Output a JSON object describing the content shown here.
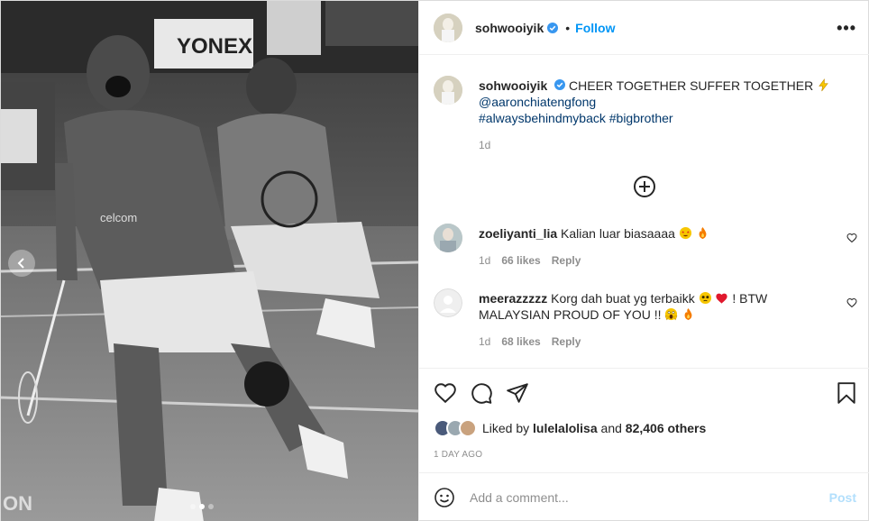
{
  "post": {
    "author": "sohwooiyik",
    "follow_label": "Follow",
    "separator": "•",
    "more_label": "•••",
    "caption": {
      "username": "sohwooiyik",
      "text": "CHEER TOGETHER SUFFER TOGETHER",
      "mention": "@aaronchiatengfong",
      "hashtag1": "#alwaysbehindmyback",
      "hashtag2": "#bigbrother",
      "time": "1d"
    },
    "comments": [
      {
        "username": "zoeliyanti_lia",
        "text": "Kalian luar biasaaaa",
        "time": "1d",
        "likes": "66 likes",
        "reply": "Reply"
      },
      {
        "username": "meerazzzzz",
        "text_part1": "Korg dah buat yg terbaikk",
        "text_part2": "! BTW",
        "text_part3": "MALAYSIAN PROUD OF YOU !!",
        "time": "1d",
        "likes": "68 likes",
        "reply": "Reply"
      }
    ],
    "likes": {
      "prefix": "Liked by",
      "user": "lulelalolisa",
      "suffix": "and",
      "count": "82,406 others"
    },
    "date": "1 DAY AGO",
    "comment_placeholder": "Add a comment...",
    "post_label": "Post",
    "photo_text": {
      "brand1": "YONEX",
      "brand2": "celcom",
      "corner": "ON"
    }
  },
  "colors": {
    "accent": "#0095f6",
    "verified": "#3897f0",
    "link": "#00376b",
    "muted": "#8e8e8e",
    "post_disabled": "#b2dffc"
  },
  "icons": {
    "verified": "verified-badge-icon",
    "load_more": "plus-circle-icon",
    "heart": "heart-icon",
    "comment": "comment-icon",
    "share": "share-icon",
    "save": "bookmark-icon",
    "emoji": "smile-icon",
    "prev": "chevron-left-icon"
  }
}
